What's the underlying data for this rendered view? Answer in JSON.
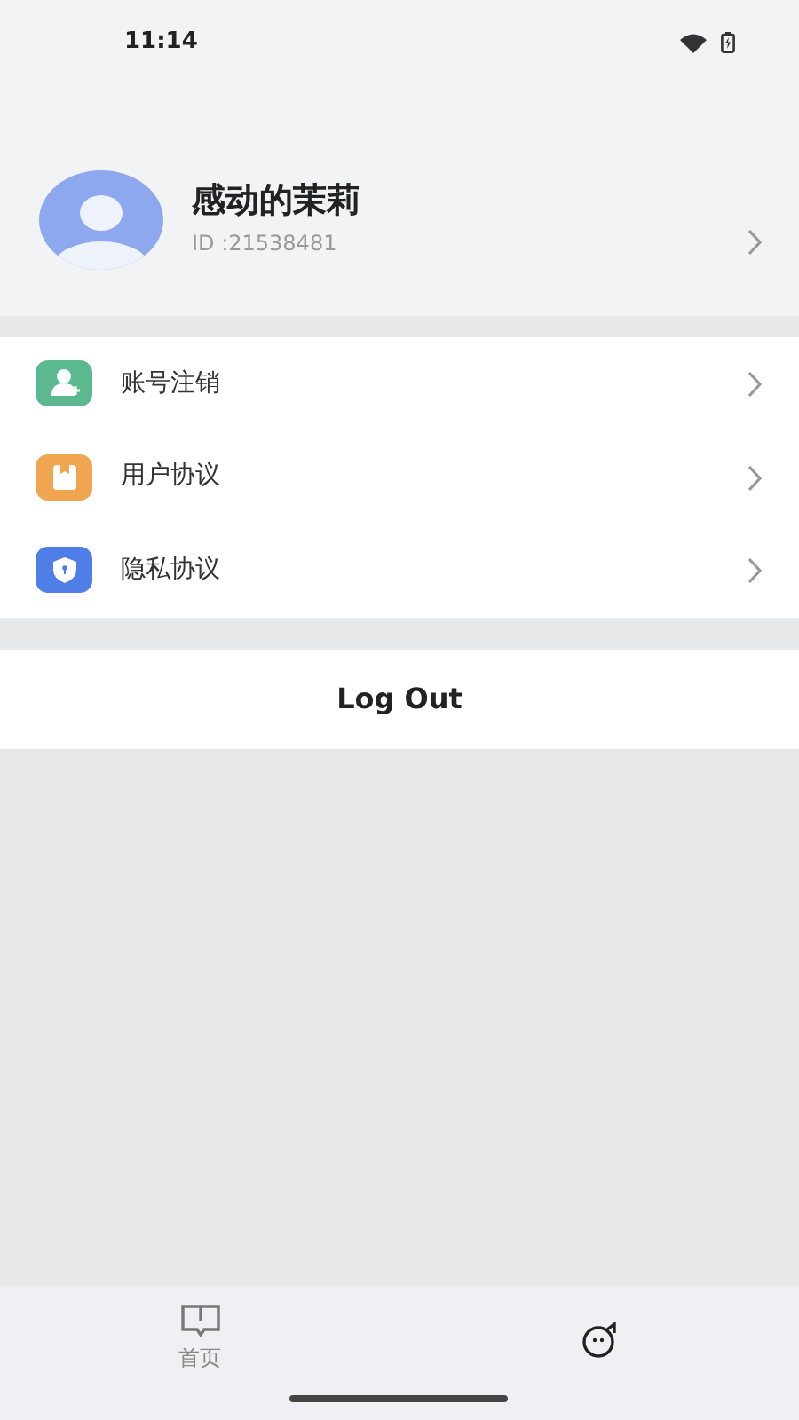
{
  "status_bar": {
    "time": "11:14"
  },
  "profile": {
    "name": "感动的茉莉",
    "id": "ID :21538481"
  },
  "menu": [
    {
      "kind": "account",
      "label": "账号注销"
    },
    {
      "kind": "agreement",
      "label": "用户协议"
    },
    {
      "kind": "privacy",
      "label": "隐私协议"
    }
  ],
  "logout": {
    "label": "Log Out"
  },
  "tabs": [
    {
      "kind": "home",
      "label": "首页",
      "selected": false
    },
    {
      "kind": "me",
      "selected": true
    }
  ]
}
